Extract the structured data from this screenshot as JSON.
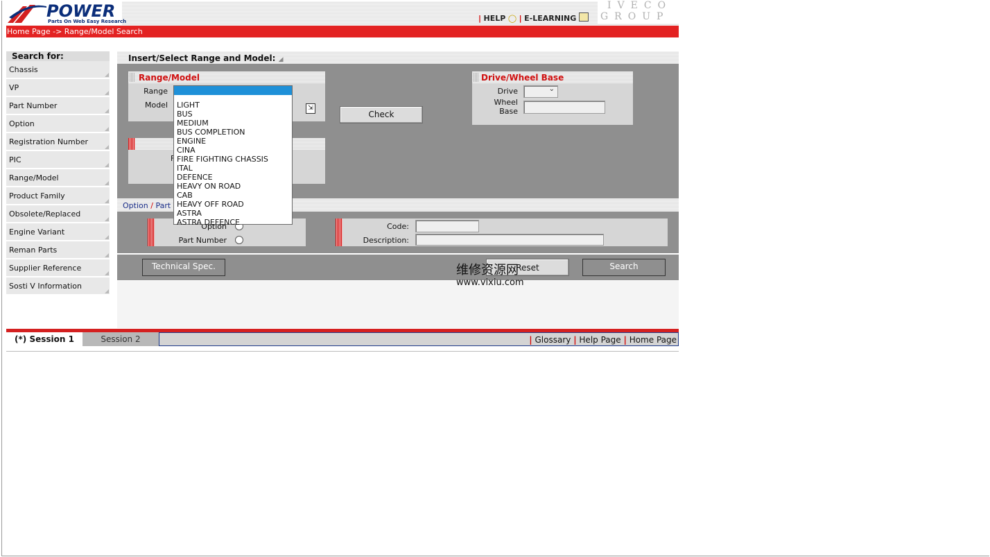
{
  "header": {
    "logo_text": "POWER",
    "logo_tagline": "Parts On Web Easy Research",
    "help_label": "HELP",
    "elearning_label": "E-LEARNING",
    "brand_line1": "IVECO",
    "brand_line2": "GROUP"
  },
  "breadcrumb": "Home Page -> Range/Model Search",
  "sidebar": {
    "title": "Search for:",
    "items": [
      {
        "label": "Chassis"
      },
      {
        "label": "VP"
      },
      {
        "label": "Part Number"
      },
      {
        "label": "Option"
      },
      {
        "label": "Registration Number"
      },
      {
        "label": "PIC"
      },
      {
        "label": "Range/Model"
      },
      {
        "label": "Product Family"
      },
      {
        "label": "Obsolete/Replaced"
      },
      {
        "label": "Engine Variant"
      },
      {
        "label": "Reman Parts"
      },
      {
        "label": "Supplier Reference"
      },
      {
        "label": "Sosti V Information"
      }
    ]
  },
  "main": {
    "panel_title": "Insert/Select Range and Model:",
    "range_model": {
      "title": "Range/Model",
      "range_label": "Range",
      "model_label": "Model",
      "range_value": "",
      "range_options": [
        "LIGHT",
        "BUS",
        "MEDIUM",
        "BUS COMPLETION",
        "ENGINE",
        "CINA",
        "FIRE FIGHTING CHASSIS",
        "ITAL",
        "DEFENCE",
        "HEAVY ON ROAD",
        "CAB",
        "HEAVY OFF ROAD",
        "ASTRA",
        "ASTRA DEFENCE"
      ]
    },
    "hidden_box_label": "F",
    "check_label": "Check",
    "drive_wheelbase": {
      "title": "Drive/Wheel Base",
      "drive_label": "Drive",
      "wheel_label_1": "Wheel",
      "wheel_label_2": "Base",
      "drive_value": "",
      "wheelbase_value": ""
    },
    "option_title_a": "Option",
    "option_title_sep": "/",
    "option_title_b": "Part",
    "option_radio_label": "Option",
    "part_number_radio_label": "Part Number",
    "code_label": "Code:",
    "description_label": "Description:",
    "code_value": "",
    "description_value": "",
    "technical_spec_label": "Technical Spec.",
    "reset_label": "Reset",
    "search_label": "Search"
  },
  "watermark": {
    "cn": "维修资源网",
    "url": "www.vixiu.com"
  },
  "footer": {
    "session1": "(*) Session 1",
    "session2": "Session 2",
    "links": [
      "Glossary",
      "Help Page",
      "Home Page"
    ]
  },
  "colors": {
    "accent_red": "#e32222",
    "panel_grey": "#8f8f8f",
    "logo_blue": "#0b2e7a",
    "selection_blue": "#1e90d8"
  }
}
